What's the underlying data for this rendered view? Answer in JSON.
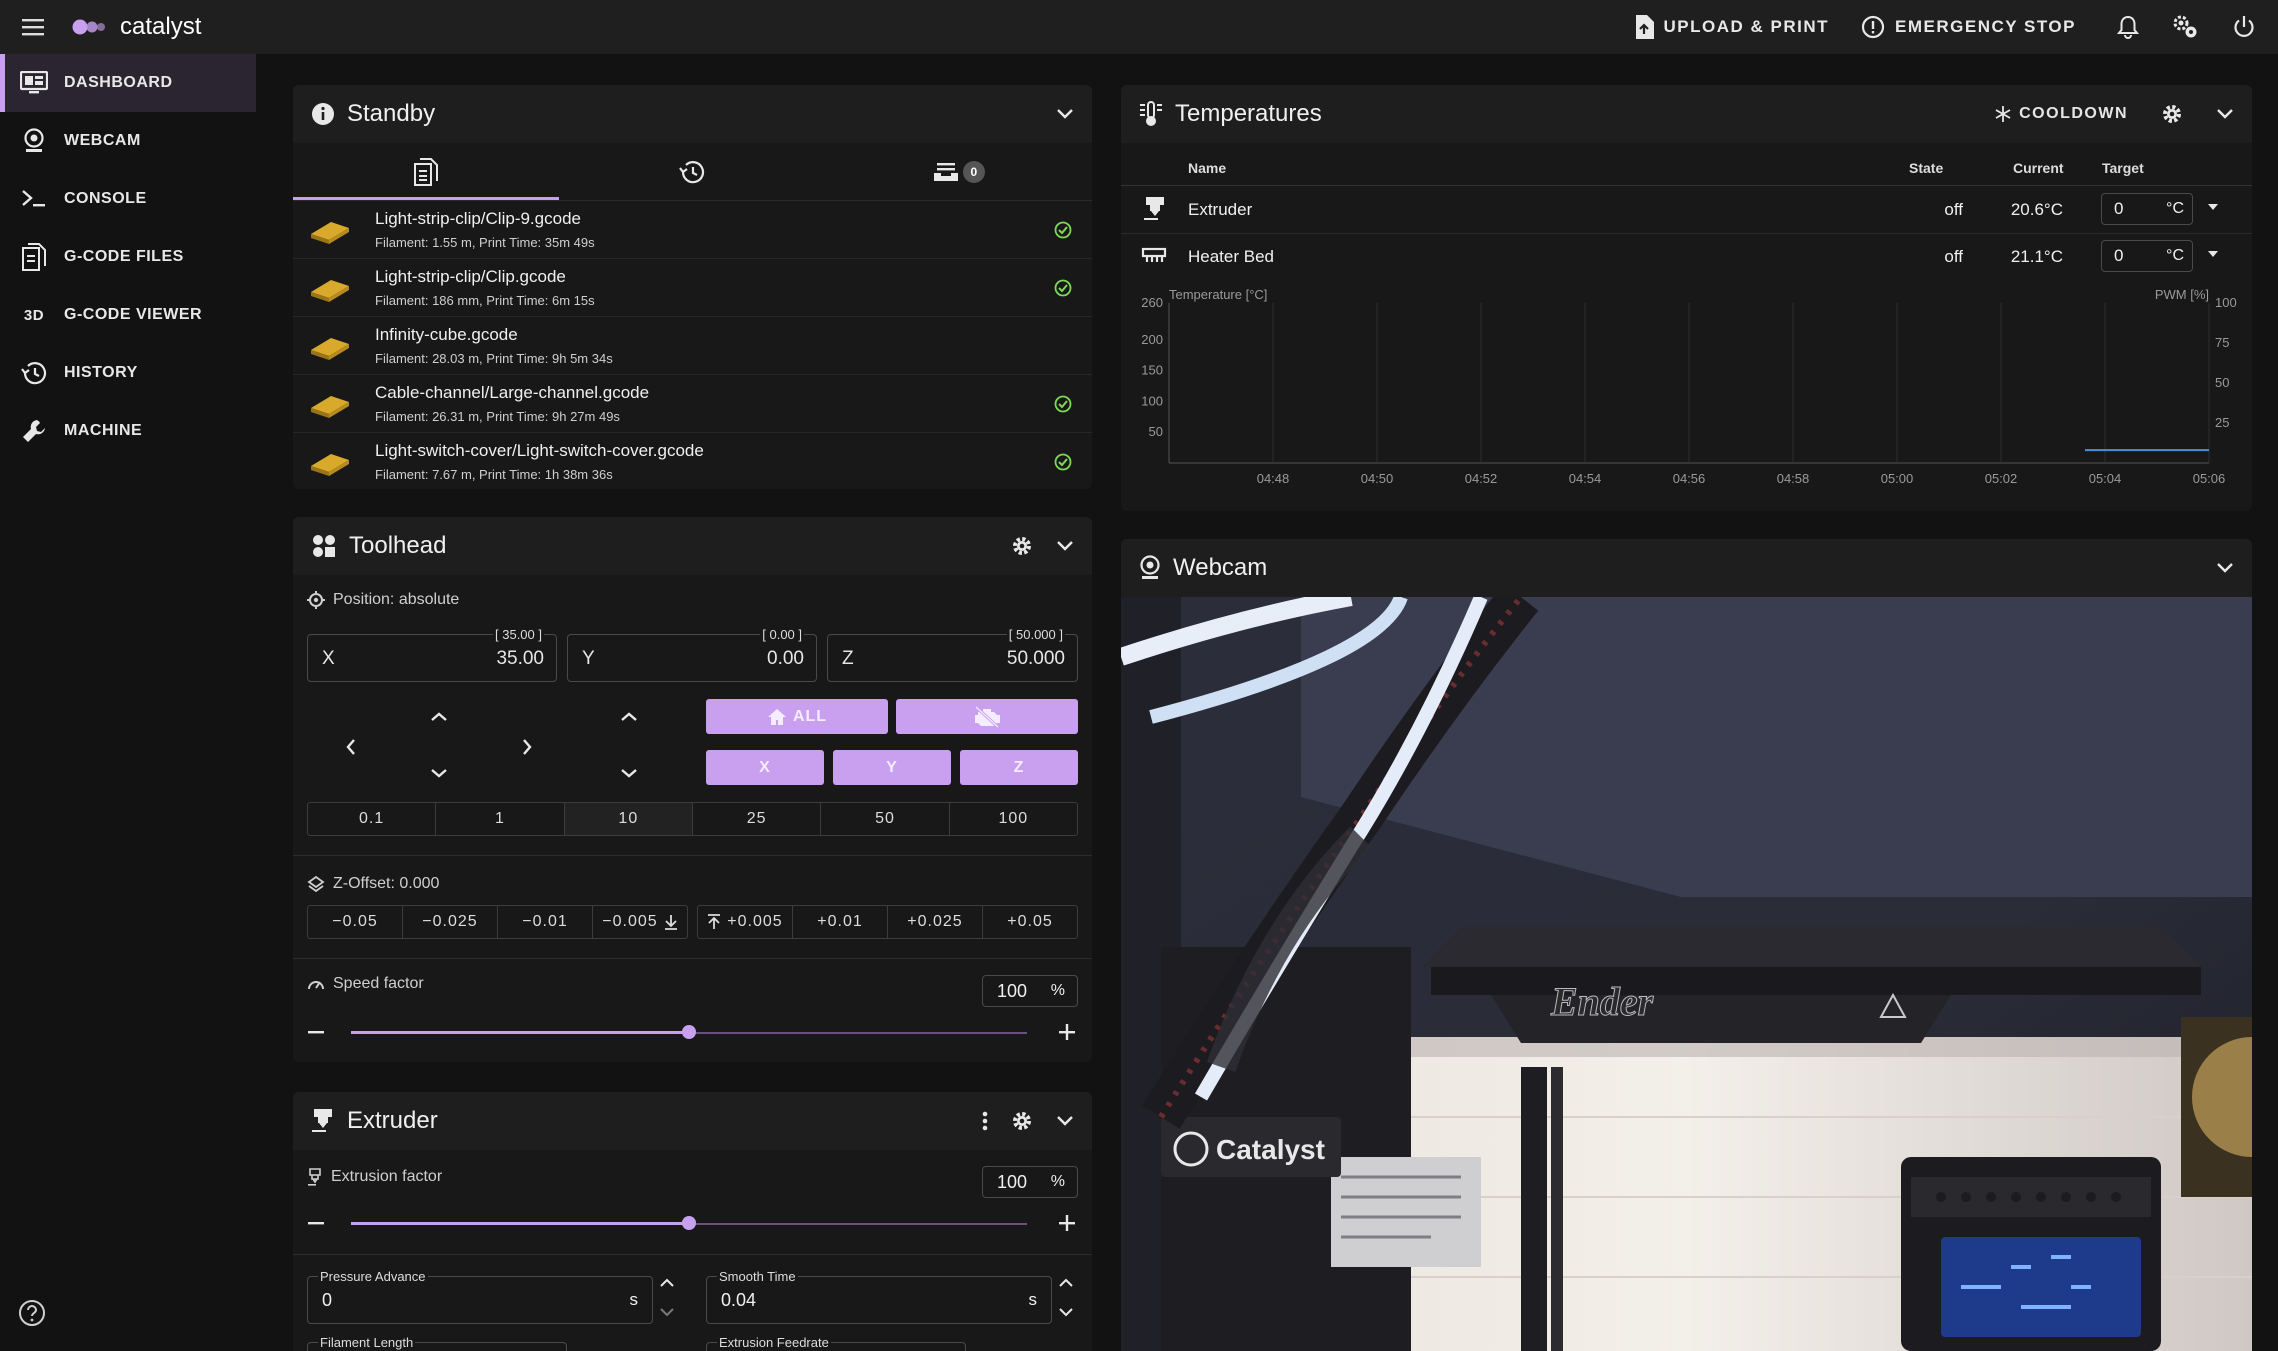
{
  "app": {
    "title": "catalyst"
  },
  "appbar": {
    "upload_label": "UPLOAD & PRINT",
    "emergency_label": "EMERGENCY STOP"
  },
  "sidebar": {
    "items": [
      {
        "label": "DASHBOARD",
        "icon": "monitor-dashboard-icon",
        "active": true
      },
      {
        "label": "WEBCAM",
        "icon": "webcam-icon"
      },
      {
        "label": "CONSOLE",
        "icon": "console-icon"
      },
      {
        "label": "G-CODE FILES",
        "icon": "file-document-icon"
      },
      {
        "label": "G-CODE VIEWER",
        "icon": "3d-icon",
        "icon_text": "3D"
      },
      {
        "label": "HISTORY",
        "icon": "history-icon"
      },
      {
        "label": "MACHINE",
        "icon": "wrench-icon"
      }
    ]
  },
  "standby": {
    "title": "Standby",
    "queue_count": "0",
    "files": [
      {
        "name": "Light-strip-clip/Clip-9.gcode",
        "meta": "Filament: 1.55 m, Print Time: 35m 49s",
        "done": true
      },
      {
        "name": "Light-strip-clip/Clip.gcode",
        "meta": "Filament: 186 mm, Print Time: 6m 15s",
        "done": true
      },
      {
        "name": "Infinity-cube.gcode",
        "meta": "Filament: 28.03 m, Print Time: 9h 5m 34s",
        "done": false
      },
      {
        "name": "Cable-channel/Large-channel.gcode",
        "meta": "Filament: 26.31 m, Print Time: 9h 27m 49s",
        "done": true
      },
      {
        "name": "Light-switch-cover/Light-switch-cover.gcode",
        "meta": "Filament: 7.67 m, Print Time: 1h 38m 36s",
        "done": true
      }
    ]
  },
  "toolhead": {
    "title": "Toolhead",
    "position_label": "Position: absolute",
    "axes": [
      {
        "axis": "X",
        "value": "35.00",
        "hint": "[ 35.00 ]"
      },
      {
        "axis": "Y",
        "value": "0.00",
        "hint": "[ 0.00 ]"
      },
      {
        "axis": "Z",
        "value": "50.000",
        "hint": "[ 50.000 ]"
      }
    ],
    "home_all_label": "ALL",
    "home_x": "X",
    "home_y": "Y",
    "home_z": "Z",
    "steps": [
      "0.1",
      "1",
      "10",
      "25",
      "50",
      "100"
    ],
    "selected_step": "10",
    "zoffset_label": "Z-Offset: 0.000",
    "zoffset_steps": [
      "−0.05",
      "−0.025",
      "−0.01",
      "−0.005",
      "+0.005",
      "+0.01",
      "+0.025",
      "+0.05"
    ],
    "speed_label": "Speed factor",
    "speed_value": "100",
    "speed_unit": "%",
    "speed_fraction": 0.5
  },
  "extruder": {
    "title": "Extruder",
    "factor_label": "Extrusion factor",
    "factor_value": "100",
    "factor_unit": "%",
    "factor_fraction": 0.5,
    "pressure_label": "Pressure Advance",
    "pressure_value": "0",
    "pressure_unit": "s",
    "smooth_label": "Smooth Time",
    "smooth_value": "0.04",
    "smooth_unit": "s",
    "filament_length_label": "Filament Length",
    "extrusion_feedrate_label": "Extrusion Feedrate"
  },
  "temperatures": {
    "title": "Temperatures",
    "cooldown_label": "COOLDOWN",
    "columns": {
      "name": "Name",
      "state": "State",
      "current": "Current",
      "target": "Target"
    },
    "rows": [
      {
        "name": "Extruder",
        "state": "off",
        "current": "20.6°C",
        "target": "0",
        "unit": "°C"
      },
      {
        "name": "Heater Bed",
        "state": "off",
        "current": "21.1°C",
        "target": "0",
        "unit": "°C"
      }
    ]
  },
  "chart_data": {
    "type": "line",
    "ylabel": "Temperature [°C]",
    "y2label": "PWM [%]",
    "ylim": [
      0,
      260
    ],
    "y2lim": [
      0,
      100
    ],
    "yticks": [
      "260",
      "200",
      "150",
      "100",
      "50"
    ],
    "y2ticks": [
      "100",
      "75",
      "50",
      "25"
    ],
    "x": [
      "04:48",
      "04:50",
      "04:52",
      "04:54",
      "04:56",
      "04:58",
      "05:00",
      "05:02",
      "05:04",
      "05:06"
    ],
    "grid": true,
    "series": [
      {
        "color": "#4a90d9",
        "points": [
          [
            "05:04",
            21
          ],
          [
            "05:06",
            21
          ]
        ]
      }
    ]
  },
  "webcam": {
    "title": "Webcam",
    "brand_text": "Ender",
    "head_text": "Catalyst"
  },
  "colors": {
    "accent": "#c9a0f0",
    "background": "#121212",
    "panel": "#1e1e1e"
  }
}
